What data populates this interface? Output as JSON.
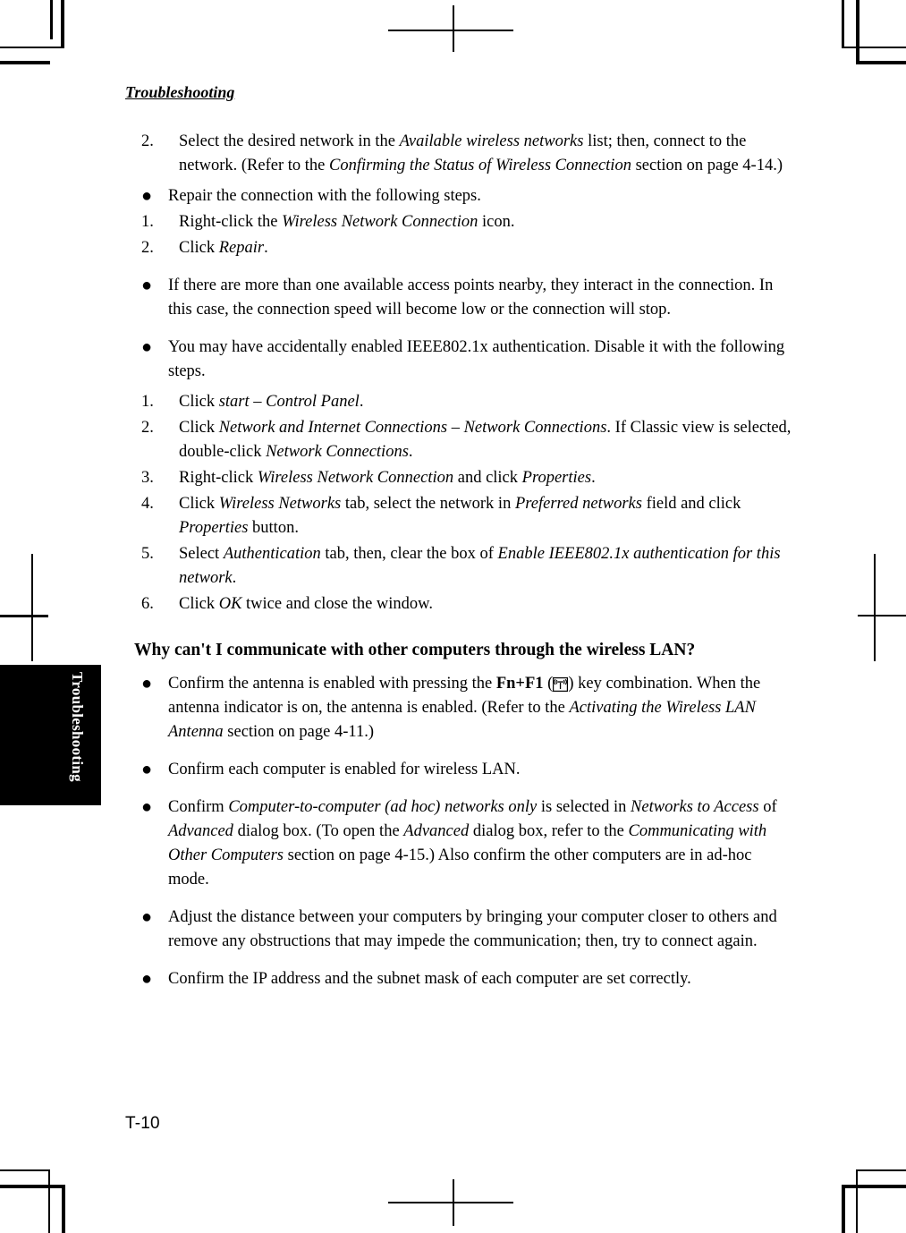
{
  "page": {
    "header_title": "Troubleshooting",
    "side_tab_label": "Troubleshooting",
    "footer_page_number": "T-10"
  },
  "icons": {
    "antenna_key_icon": "wireless-antenna-icon"
  },
  "content": {
    "step_2_number": "2.",
    "step_2_text_a": "Select the desired network in the ",
    "step_2_italic_a": "Available wireless networks",
    "step_2_text_b": " list; then, connect to the network. (Refer to the ",
    "step_2_italic_b": "Confirming the Status of Wireless Connection",
    "step_2_text_c": " section on page 4-14.)",
    "bullet_repair_marker": "●",
    "bullet_repair_text": "Repair the connection with the following steps.",
    "repair_1_number": "1.",
    "repair_1_text_a": "Right-click the ",
    "repair_1_italic": "Wireless Network Connection",
    "repair_1_text_b": " icon.",
    "repair_2_number": "2.",
    "repair_2_text_a": "Click ",
    "repair_2_italic": "Repair",
    "repair_2_text_b": ".",
    "bullet_access_points_marker": "●",
    "bullet_access_points_text": "If there are more than one available access points nearby, they interact in the connection. In this case, the connection speed will become low or the connection will stop.",
    "bullet_ieee_marker": "●",
    "bullet_ieee_text": "You may have accidentally enabled IEEE802.1x authentication. Disable it with the following steps.",
    "ieee_1_number": "1.",
    "ieee_1_text_a": "Click ",
    "ieee_1_italic": "start – Control Panel",
    "ieee_1_text_b": ".",
    "ieee_2_number": "2.",
    "ieee_2_text_a": "Click ",
    "ieee_2_italic_a": "Network and Internet Connections – Network Connections",
    "ieee_2_text_b": ". If Classic view is selected, double-click ",
    "ieee_2_italic_b": "Network Connections",
    "ieee_2_text_c": ".",
    "ieee_3_number": "3.",
    "ieee_3_text_a": " Right-click ",
    "ieee_3_italic_a": "Wireless Network Connection",
    "ieee_3_text_b": " and click ",
    "ieee_3_italic_b": "Properties",
    "ieee_3_text_c": ".",
    "ieee_4_number": "4.",
    "ieee_4_text_a": "Click ",
    "ieee_4_italic_a": "Wireless Networks",
    "ieee_4_text_b": " tab, select the network in ",
    "ieee_4_italic_b": "Preferred networks",
    "ieee_4_text_c": " field and click ",
    "ieee_4_italic_c": "Properties",
    "ieee_4_text_d": " button.",
    "ieee_5_number": "5.",
    "ieee_5_text_a": "Select ",
    "ieee_5_italic_a": "Authentication",
    "ieee_5_text_b": " tab, then, clear the box of ",
    "ieee_5_italic_b": "Enable IEEE802.1x authentication for this network",
    "ieee_5_text_c": ".",
    "ieee_6_number": "6.",
    "ieee_6_text_a": "Click ",
    "ieee_6_italic": "OK",
    "ieee_6_text_b": " twice and close the window.",
    "section_heading": "Why can't I communicate with other computers through the wireless LAN?",
    "bullet_antenna_marker": "●",
    "bullet_antenna_text_a": "Confirm the antenna is enabled with pressing the ",
    "bullet_antenna_bold": "Fn+F1",
    "bullet_antenna_text_b": " (",
    "bullet_antenna_text_c": ") key combination. When the antenna indicator is on, the antenna is enabled. (Refer to the ",
    "bullet_antenna_italic": "Activating the Wireless LAN Antenna",
    "bullet_antenna_text_d": " section on page 4-11.)",
    "bullet_each_computer_marker": "●",
    "bullet_each_computer_text": "Confirm each computer is enabled for wireless LAN.",
    "bullet_adhoc_marker": "●",
    "bullet_adhoc_text_a": "Confirm ",
    "bullet_adhoc_italic_a": "Computer-to-computer (ad hoc) networks only",
    "bullet_adhoc_text_b": " is selected in ",
    "bullet_adhoc_italic_b": "Networks to Access",
    "bullet_adhoc_text_c": " of ",
    "bullet_adhoc_italic_c": "Advanced",
    "bullet_adhoc_text_d": " dialog box. (To open the ",
    "bullet_adhoc_italic_d": "Advanced",
    "bullet_adhoc_text_e": " dialog box, refer to the ",
    "bullet_adhoc_italic_e": "Communicating with Other Computers",
    "bullet_adhoc_text_f": " section on page 4-15.) Also confirm the other computers are in ad-hoc mode.",
    "bullet_distance_marker": "●",
    "bullet_distance_text": "Adjust the distance between your computers by bringing your computer closer to others and remove any obstructions that may impede the communication; then, try to connect again.",
    "bullet_ip_marker": "●",
    "bullet_ip_text": "Confirm the IP address and the subnet mask of each computer are set correctly."
  }
}
